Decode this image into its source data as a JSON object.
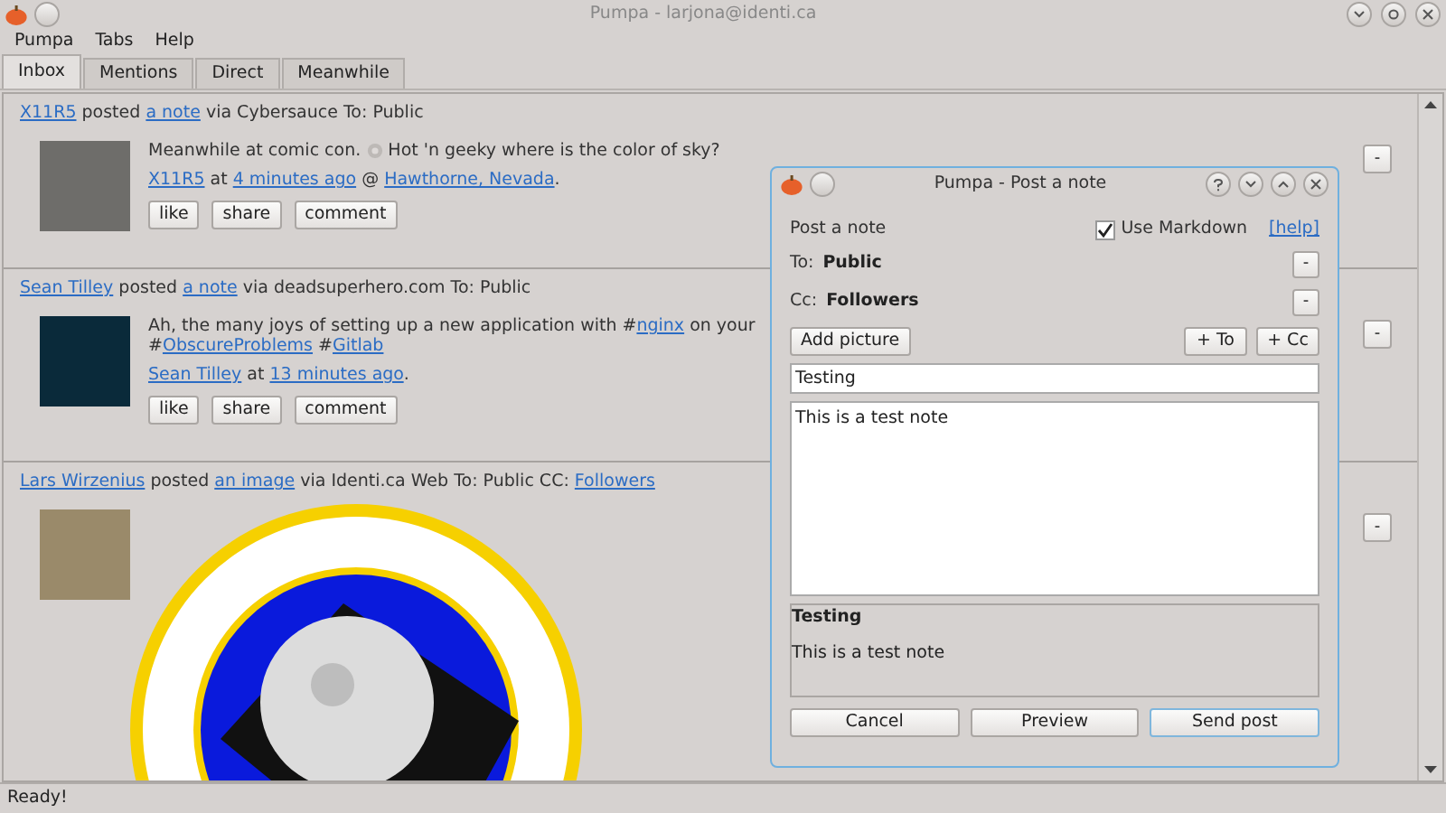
{
  "window": {
    "title": "Pumpa - larjona@identi.ca"
  },
  "menu": [
    "Pumpa",
    "Tabs",
    "Help"
  ],
  "tabs": [
    {
      "label": "Inbox",
      "selected": true
    },
    {
      "label": "Mentions",
      "selected": false
    },
    {
      "label": "Direct",
      "selected": false
    },
    {
      "label": "Meanwhile",
      "selected": false
    }
  ],
  "posts": [
    {
      "kind": "note",
      "header": [
        {
          "kind": "link",
          "text": "X11R5"
        },
        {
          "kind": "text",
          "text": " posted "
        },
        {
          "kind": "link",
          "text": "a note"
        },
        {
          "kind": "text",
          "text": " via Cybersauce To: Public"
        }
      ],
      "body": [
        [
          {
            "kind": "text",
            "text": "Meanwhile at comic con. "
          },
          {
            "kind": "icon"
          },
          {
            "kind": "text",
            "text": " Hot 'n geeky where is the color of sky?"
          }
        ]
      ],
      "meta": [
        {
          "kind": "link",
          "text": "X11R5"
        },
        {
          "kind": "text",
          "text": " at "
        },
        {
          "kind": "link",
          "text": "4 minutes ago"
        },
        {
          "kind": "text",
          "text": " @ "
        },
        {
          "kind": "link",
          "text": "Hawthorne, Nevada"
        },
        {
          "kind": "text",
          "text": "."
        }
      ],
      "actions": [
        "like",
        "share",
        "comment"
      ],
      "collapse": "-"
    },
    {
      "kind": "note",
      "header": [
        {
          "kind": "link",
          "text": "Sean Tilley"
        },
        {
          "kind": "text",
          "text": " posted "
        },
        {
          "kind": "link",
          "text": "a note"
        },
        {
          "kind": "text",
          "text": " via deadsuperhero.com To: Public"
        }
      ],
      "body": [
        [
          {
            "kind": "text",
            "text": "Ah, the many joys of setting up a new application with #"
          },
          {
            "kind": "link",
            "text": "nginx"
          },
          {
            "kind": "text",
            "text": " on your"
          }
        ],
        [
          {
            "kind": "text",
            "text": "#"
          },
          {
            "kind": "link",
            "text": "ObscureProblems"
          },
          {
            "kind": "text",
            "text": " #"
          },
          {
            "kind": "link",
            "text": "Gitlab"
          }
        ]
      ],
      "meta": [
        {
          "kind": "link",
          "text": "Sean Tilley"
        },
        {
          "kind": "text",
          "text": " at "
        },
        {
          "kind": "link",
          "text": "13 minutes ago"
        },
        {
          "kind": "text",
          "text": "."
        }
      ],
      "actions": [
        "like",
        "share",
        "comment"
      ],
      "collapse": "-"
    },
    {
      "kind": "image",
      "header": [
        {
          "kind": "link",
          "text": "Lars Wirzenius"
        },
        {
          "kind": "text",
          "text": " posted "
        },
        {
          "kind": "link",
          "text": "an image"
        },
        {
          "kind": "text",
          "text": " via Identi.ca Web To: Public CC: "
        },
        {
          "kind": "link",
          "text": "Followers"
        }
      ],
      "collapse": "-"
    }
  ],
  "dialog": {
    "title": "Pumpa - Post a note",
    "heading": "Post a note",
    "markdown": {
      "label": "Use Markdown",
      "checked": true
    },
    "help": "[help]",
    "to": {
      "label": "To:",
      "value": "Public",
      "remove": "-"
    },
    "cc": {
      "label": "Cc:",
      "value": "Followers",
      "remove": "-"
    },
    "add_picture": "Add picture",
    "add_to": "+ To",
    "add_cc": "+ Cc",
    "title_value": "Testing",
    "body_value": "This is a test note",
    "preview": {
      "title": "Testing",
      "body": "This is a test note"
    },
    "buttons": [
      {
        "label": "Cancel",
        "default": false
      },
      {
        "label": "Preview",
        "default": false
      },
      {
        "label": "Send post",
        "default": true
      }
    ]
  },
  "status_bar": "Ready!"
}
